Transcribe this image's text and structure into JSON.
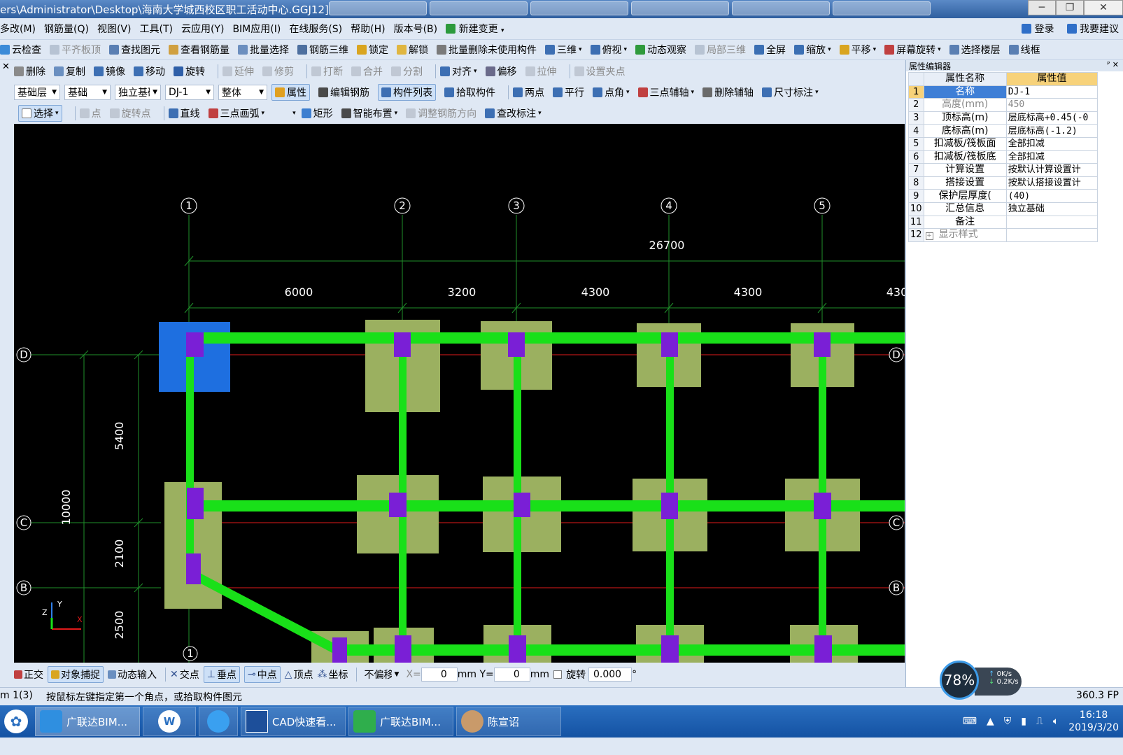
{
  "window": {
    "title": "ers\\Administrator\\Desktop\\海南大学城西校区职工活动中心.GGJ12]",
    "controls": [
      "─",
      "❐",
      "✕"
    ]
  },
  "menu": {
    "items": [
      "多改(M)",
      "钢筋量(Q)",
      "视图(V)",
      "工具(T)",
      "云应用(Y)",
      "BIM应用(I)",
      "在线服务(S)",
      "帮助(H)",
      "版本号(B)",
      "新建变更"
    ],
    "login": "登录",
    "suggest": "我要建议"
  },
  "toolbar1": {
    "items": [
      "云检查",
      "平齐板顶",
      "查找图元",
      "查看钢筋量",
      "批量选择",
      "钢筋三维",
      "锁定",
      "解锁",
      "批量删除未使用构件",
      "三维",
      "俯视",
      "动态观察",
      "局部三维",
      "全屏",
      "缩放",
      "平移",
      "屏幕旋转",
      "选择楼层",
      "线框"
    ]
  },
  "toolbar2": {
    "items": [
      "删除",
      "复制",
      "镜像",
      "移动",
      "旋转",
      "延伸",
      "修剪",
      "打断",
      "合并",
      "分割",
      "对齐",
      "偏移",
      "拉伸",
      "设置夹点"
    ]
  },
  "toolbar3": {
    "combo_floor": "基础层",
    "combo_type": "基础",
    "combo_sub": "独立基础",
    "combo_name": "DJ-1",
    "combo_whole": "整体",
    "items": [
      "属性",
      "编辑钢筋",
      "构件列表",
      "拾取构件",
      "两点",
      "平行",
      "点角",
      "三点辅轴",
      "删除辅轴",
      "尺寸标注"
    ]
  },
  "toolbar4": {
    "items": [
      "选择",
      "点",
      "旋转点",
      "直线",
      "三点画弧",
      "矩形",
      "智能布置",
      "调整钢筋方向",
      "查改标注"
    ]
  },
  "left_strip_close": "✕",
  "drawing": {
    "axes_top": [
      "1",
      "2",
      "3",
      "4",
      "5"
    ],
    "axes_left": [
      "D",
      "C",
      "B"
    ],
    "axes_right": [
      "D",
      "C",
      "B"
    ],
    "axis_bottom": "1",
    "total_dim": "26700",
    "spans": [
      "6000",
      "3200",
      "4300",
      "4300",
      "430"
    ],
    "vertical_total": "10000",
    "vertical_spans": [
      "5400",
      "2100",
      "2500"
    ],
    "ucs": {
      "x": "X",
      "y": "Y",
      "z": "Z"
    }
  },
  "properties": {
    "panel_title": "属性编辑器",
    "pins": "ᴾ ✕",
    "col_name": "属性名称",
    "col_value": "属性值",
    "rows": [
      {
        "idx": "1",
        "name": "名称",
        "value": "DJ-1"
      },
      {
        "idx": "2",
        "name": "高度(mm)",
        "value": "450"
      },
      {
        "idx": "3",
        "name": "顶标高(m)",
        "value": "层底标高+0.45(-0"
      },
      {
        "idx": "4",
        "name": "底标高(m)",
        "value": "层底标高(-1.2)"
      },
      {
        "idx": "5",
        "name": "扣减板/筏板面",
        "value": "全部扣减"
      },
      {
        "idx": "6",
        "name": "扣减板/筏板底",
        "value": "全部扣减"
      },
      {
        "idx": "7",
        "name": "计算设置",
        "value": "按默认计算设置计"
      },
      {
        "idx": "8",
        "name": "搭接设置",
        "value": "按默认搭接设置计"
      },
      {
        "idx": "9",
        "name": "保护层厚度(",
        "value": "(40)"
      },
      {
        "idx": "10",
        "name": "汇总信息",
        "value": "独立基础"
      },
      {
        "idx": "11",
        "name": "备注",
        "value": ""
      },
      {
        "idx": "12",
        "name": "显示样式",
        "value": ""
      }
    ]
  },
  "statusbar": {
    "items": [
      "正交",
      "对象捕捉",
      "动态输入",
      "交点",
      "垂点",
      "中点",
      "顶点",
      "坐标"
    ],
    "offset": "不偏移",
    "x_label": "X=",
    "x_value": "0",
    "y_label": "mm Y=",
    "y_value": "0",
    "mm": "mm",
    "rotate_label": "旋转",
    "rotate_value": "0.000",
    "degree": "°"
  },
  "prompt": {
    "coord": "m 1(3)",
    "message": "按鼠标左键指定第一个角点，或拾取构件图元",
    "fps": "360.3 FP"
  },
  "speed": {
    "percent": "78%",
    "up": "0K/s",
    "down": "0.2K/s"
  },
  "taskbar": {
    "tasks": [
      "广联达BIM...",
      "",
      "",
      "CAD快速看...",
      "广联达BIM...",
      "陈宣诏"
    ],
    "time": "16:18",
    "date": "2019/3/20"
  },
  "colors": {
    "beam": "#19e019",
    "column": "#7a1fd6",
    "footing": "#9bb060",
    "selected_footing": "#1e6fe0",
    "axis": "#1f8f2a",
    "axis_red": "#e01a1a"
  }
}
